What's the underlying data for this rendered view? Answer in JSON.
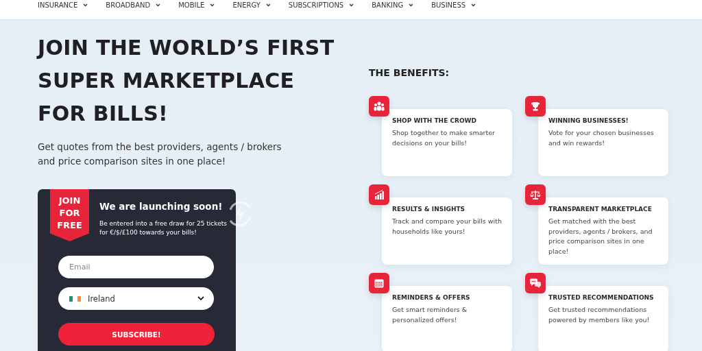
{
  "nav": [
    {
      "label": "INSURANCE"
    },
    {
      "label": "BROADBAND"
    },
    {
      "label": "MOBILE"
    },
    {
      "label": "ENERGY"
    },
    {
      "label": "SUBSCRIPTIONS"
    },
    {
      "label": "BANKING"
    },
    {
      "label": "BUSINESS"
    }
  ],
  "hero": {
    "headline": [
      "JOIN THE WORLD’S FIRST",
      "SUPER MARKETPLACE",
      "FOR BILLS!"
    ],
    "subtitle": "Get quotes from the best providers, agents / brokers and price comparison sites in one place!"
  },
  "signup": {
    "ribbon": [
      "JOIN",
      "FOR",
      "FREE"
    ],
    "title": "We are launching soon!",
    "text": "Be entered into a free draw for 25 tickets for €/$/£100 towards your bills!",
    "email_placeholder": "Email",
    "country": "Ireland",
    "button": "SUBSCRIBE!"
  },
  "benefits": {
    "heading": "THE BENEFITS:",
    "items": [
      {
        "kind": "people",
        "title": "SHOP WITH THE CROWD",
        "text": "Shop together to make smarter decisions on your bills!"
      },
      {
        "kind": "trophy",
        "title": "WINNING BUSINESSES!",
        "text": "Vote for your chosen businesses and win rewards!"
      },
      {
        "kind": "chart",
        "title": "RESULTS & INSIGHTS",
        "text": "Track and compare your bills with households like yours!"
      },
      {
        "kind": "scales",
        "title": "TRANSPARENT MARKETPLACE",
        "text": "Get matched with the best providers, agents / brokers, and price comparison sites in one place!"
      },
      {
        "kind": "calendar",
        "title": "REMINDERS & OFFERS",
        "text": "Get smart reminders & personalized offers!"
      },
      {
        "kind": "chat",
        "title": "TRUSTED RECOMMENDATIONS",
        "text": "Get trusted recommendations powered by members like you!"
      }
    ]
  }
}
